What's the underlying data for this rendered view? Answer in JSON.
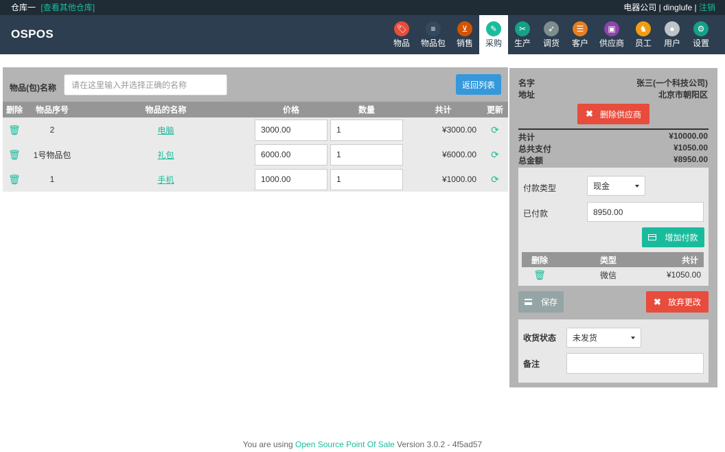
{
  "topbar": {
    "store": "仓库一",
    "store_link": "[查看其他仓库]",
    "company": "电器公司",
    "sep1": "|",
    "user": "dinglufe",
    "sep2": "|",
    "logout": "注销"
  },
  "brand": "OSPOS",
  "nav": [
    {
      "label": "物品",
      "icon": "tag-icon",
      "color": "#e74c3c"
    },
    {
      "label": "物品包",
      "icon": "stack-icon",
      "color": "#34495e"
    },
    {
      "label": "销售",
      "icon": "basket-icon",
      "color": "#d35400"
    },
    {
      "label": "采购",
      "icon": "receipt-icon",
      "color": "#1abc9c",
      "active": true
    },
    {
      "label": "生产",
      "icon": "tools-icon",
      "color": "#16a085"
    },
    {
      "label": "调货",
      "icon": "rocket-icon",
      "color": "#7f8c8d"
    },
    {
      "label": "客户",
      "icon": "contact-icon",
      "color": "#e67e22"
    },
    {
      "label": "供应商",
      "icon": "briefcase-icon",
      "color": "#8e44ad"
    },
    {
      "label": "员工",
      "icon": "runner-icon",
      "color": "#f39c12"
    },
    {
      "label": "用户",
      "icon": "user-icon",
      "color": "#bdc3c7"
    },
    {
      "label": "设置",
      "icon": "gear-icon",
      "color": "#16a085"
    }
  ],
  "search": {
    "label": "物品(包)名称",
    "placeholder": "请在这里输入并选择正确的名称",
    "return_button": "返回列表"
  },
  "cart": {
    "headers": [
      "删除",
      "物品序号",
      "物品的名称",
      "价格",
      "数量",
      "共计",
      "更新"
    ],
    "rows": [
      {
        "number": "2",
        "name": "电脑",
        "price": "3000.00",
        "qty": "1",
        "total": "¥3000.00"
      },
      {
        "number": "1号物品包",
        "name": "礼包",
        "price": "6000.00",
        "qty": "1",
        "total": "¥6000.00"
      },
      {
        "number": "1",
        "name": "手机",
        "price": "1000.00",
        "qty": "1",
        "total": "¥1000.00"
      }
    ]
  },
  "supplier": {
    "name_label": "名字",
    "name_value": "张三(一个科技公司)",
    "address_label": "地址",
    "address_value": "北京市朝阳区",
    "remove_button": "删除供应商"
  },
  "summary": {
    "total_label": "共计",
    "total_value": "¥10000.00",
    "paid_label": "总共支付",
    "paid_value": "¥1050.00",
    "amount_label": "总金额",
    "amount_value": "¥8950.00"
  },
  "payment": {
    "type_label": "付款类型",
    "type_value": "现金",
    "paid_label": "已付款",
    "paid_value": "8950.00",
    "add_button": "增加付款",
    "headers": [
      "删除",
      "类型",
      "共计"
    ],
    "rows": [
      {
        "type": "微信",
        "amount": "¥1050.00"
      }
    ]
  },
  "actions": {
    "save": "保存",
    "cancel": "放弃更改"
  },
  "receive": {
    "status_label": "收货状态",
    "status_value": "未发货",
    "note_label": "备注",
    "note_value": ""
  },
  "footer": {
    "prefix": "You are using",
    "link": "Open Source Point Of Sale",
    "suffix": "Version 3.0.2 - 4f5ad57"
  }
}
